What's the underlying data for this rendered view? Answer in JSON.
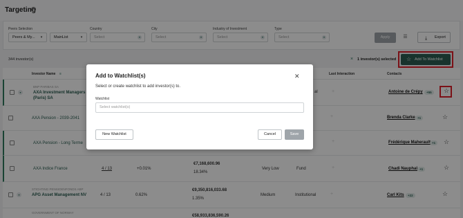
{
  "header": {
    "title": "Targeting",
    "info_icon": "info-icon"
  },
  "filters": {
    "peers_selection": {
      "label": "Peers Selection",
      "value": "Peers & My...",
      "list_value": "MainList"
    },
    "country": {
      "label": "Country",
      "placeholder": "Select"
    },
    "city": {
      "label": "City",
      "placeholder": "Select"
    },
    "industry": {
      "label": "Industry of Investment",
      "placeholder": "Select"
    },
    "type": {
      "label": "Type",
      "placeholder": "Select"
    },
    "apply_label": "Apply",
    "export_label": "Export"
  },
  "toolbar": {
    "count": "344 investor(s)",
    "selected": "1 investor(s) selected",
    "add_watchlist_label": "Add To Watchlist"
  },
  "table": {
    "headers": {
      "investor_name": "Investor Name",
      "last_interaction": "Last Interaction",
      "contacts": "Contacts"
    },
    "rows": [
      {
        "parent": "BNP PARIBAS SA",
        "name": "AXA Investment Managers (Paris) SA",
        "style": "",
        "contact": "Antoine de Crépy",
        "badge": "+55"
      },
      {
        "name": "AXA Pension - 2039-2041",
        "contact": "Brenda Clarke",
        "badge": "+1"
      },
      {
        "name": "AXA Pension - Long Terme",
        "contact": "Frédérique Maherault",
        "badge": "+1"
      },
      {
        "name": "AXA Indice France",
        "peers": "4 / 13",
        "change": "+0.01%",
        "value": "€7,168,600.96",
        "pct": "18.34%",
        "style": "Very Low",
        "type": "Fund",
        "contact": "Chadi Nauphal",
        "badge": "+1"
      },
      {
        "parent": "STICHTING PENSIOENFONDS ABP",
        "name": "APG Asset Management NV",
        "peers": "4 / 13",
        "change": "0.62%",
        "value": "€9,350,816,033.68",
        "pct": "1.35%",
        "style": "Medium",
        "type": "Institutional",
        "contact": "Carl Kits",
        "badge": "+22"
      },
      {
        "parent": "GOVERNMENT OF NORWAY",
        "value": "€58,933,836,590.26"
      }
    ],
    "row1_type_partial": "al"
  },
  "modal": {
    "title": "Add to Watchlist(s)",
    "subtitle": "Select or create watchlist to add investor(s) to.",
    "field_label": "Watchlist",
    "field_placeholder": "Select watchlist(s)",
    "new_label": "New Watchlist",
    "cancel_label": "Cancel",
    "save_label": "Save"
  },
  "colors": {
    "accent": "#2c5e52",
    "highlight": "#e0202a",
    "overlay": "rgba(0,0,0,0.45)"
  }
}
